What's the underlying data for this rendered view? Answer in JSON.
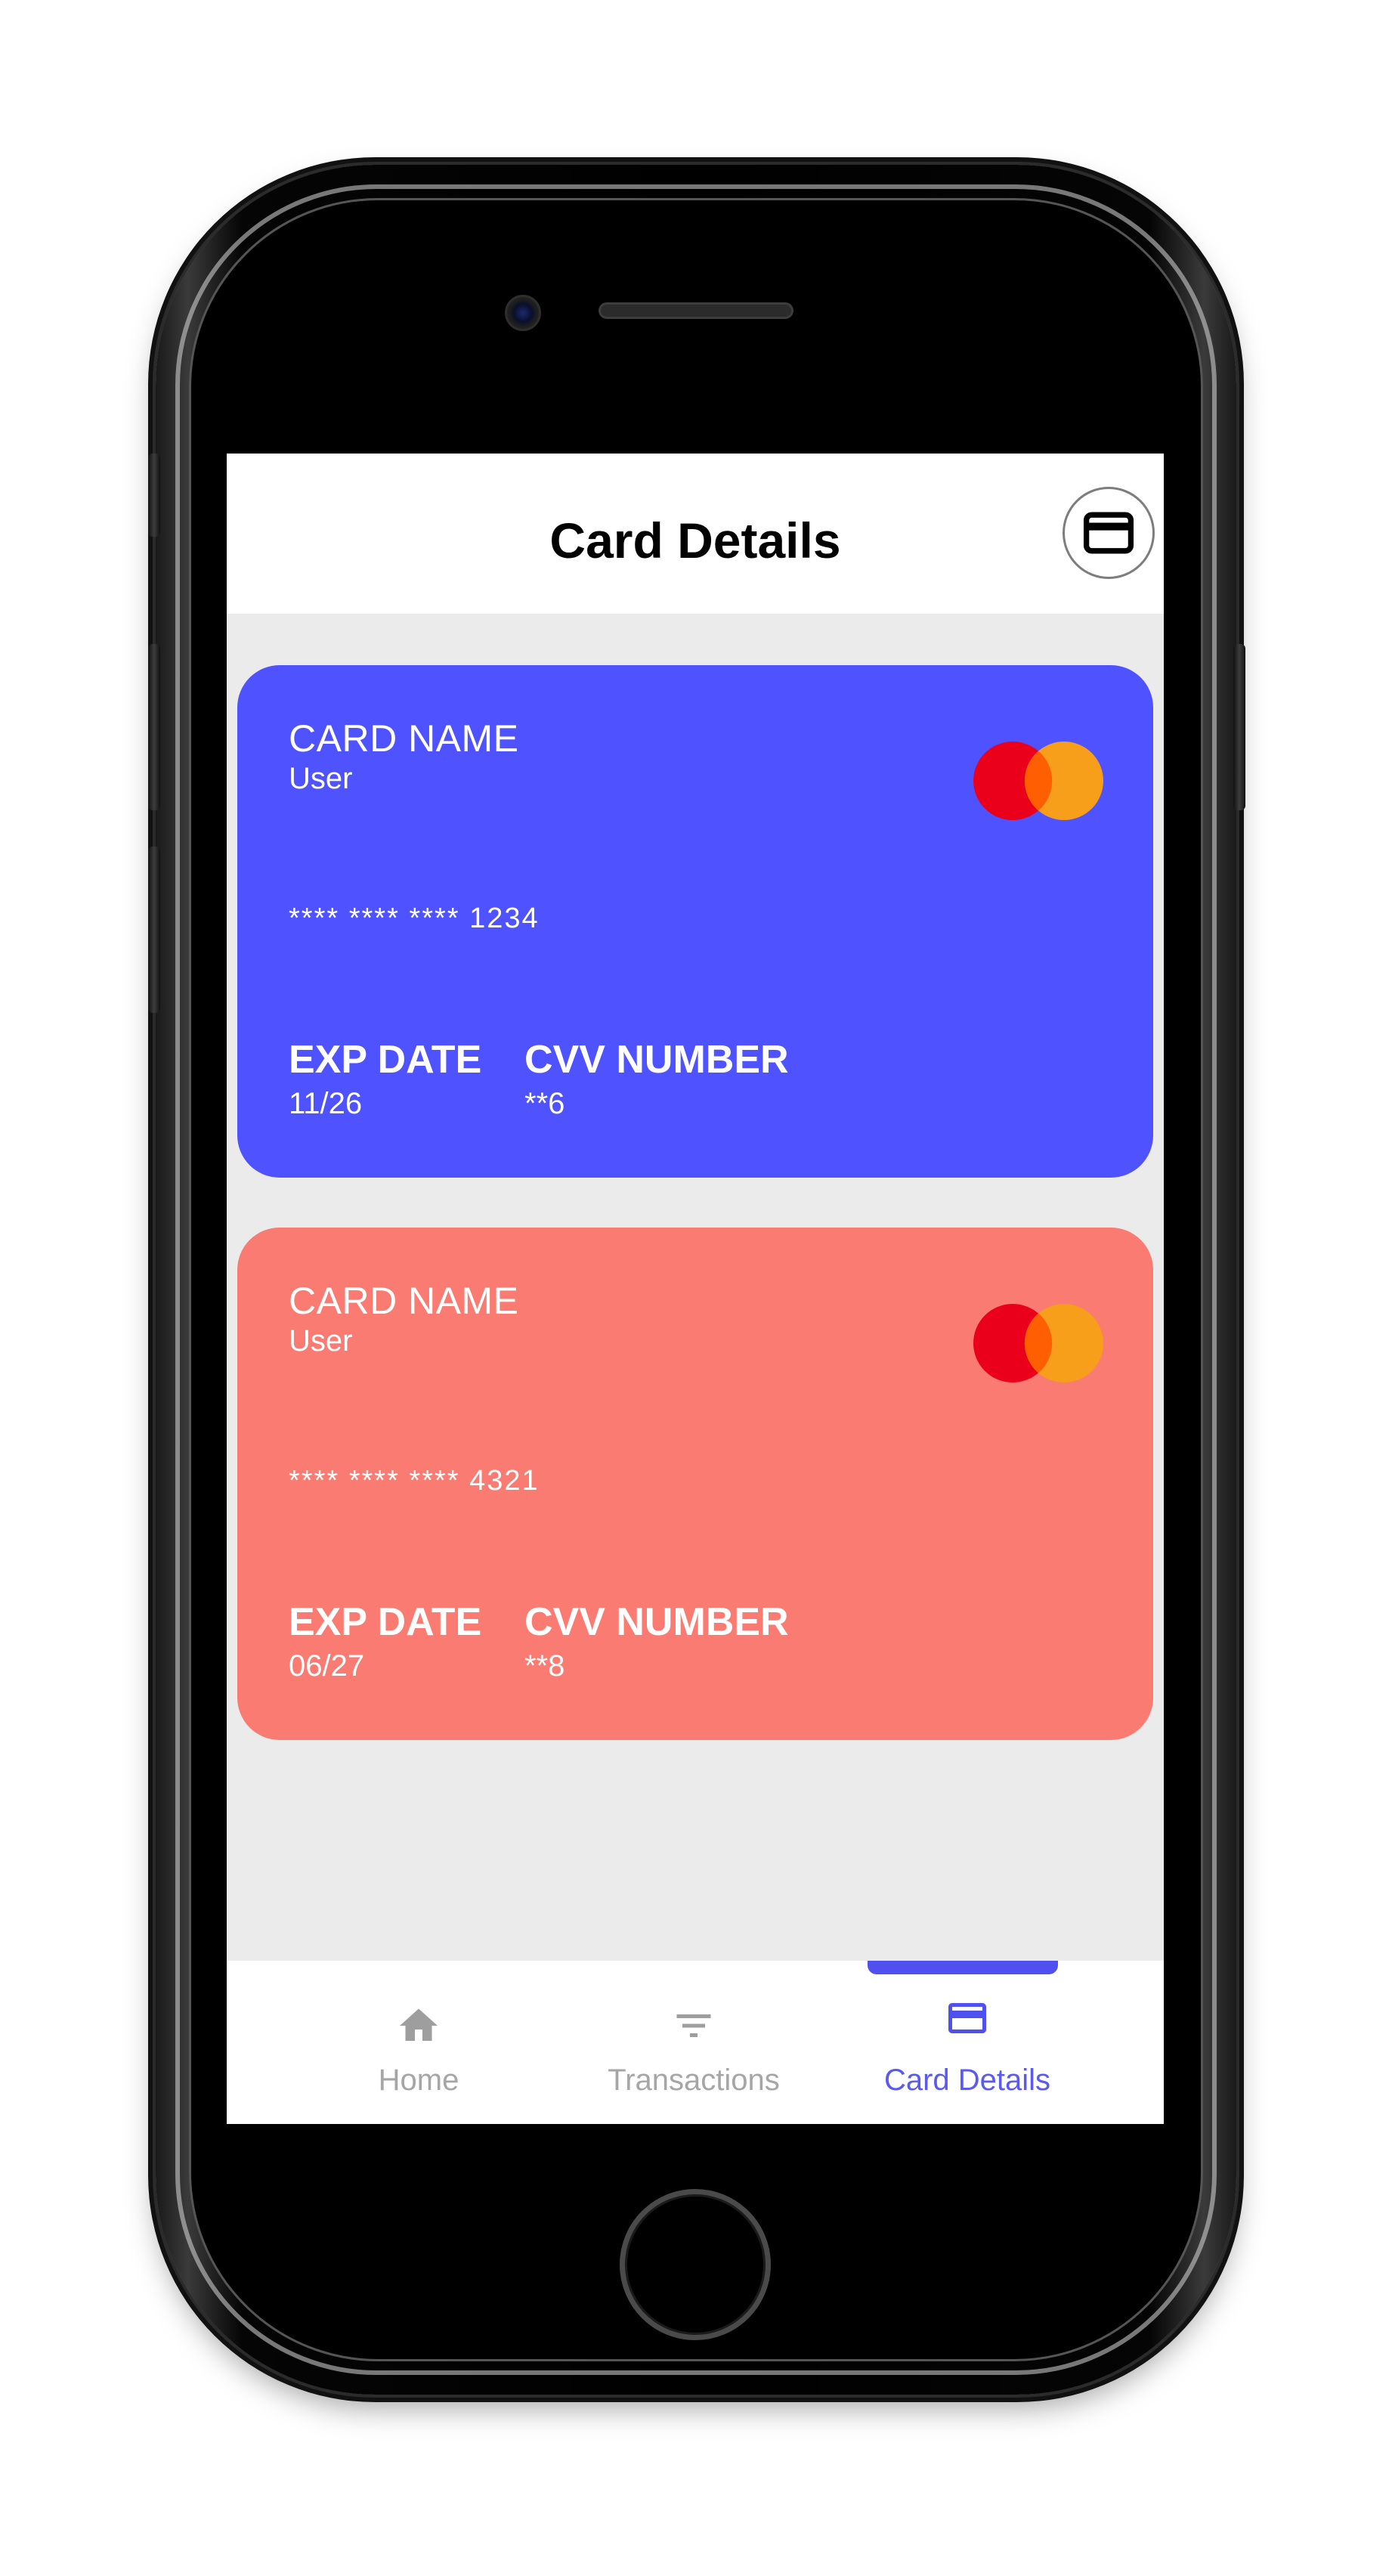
{
  "header": {
    "title": "Card Details",
    "action_icon": "credit-card-icon"
  },
  "cards": [
    {
      "name_label": "CARD NAME",
      "name_value": "User",
      "number": "**** **** **** 1234",
      "exp_label": "EXP DATE",
      "exp_value": "11/26",
      "cvv_label": "CVV NUMBER",
      "cvv_value": "**6",
      "color": "#4f52ff",
      "brand_icon": "mastercard-logo-icon"
    },
    {
      "name_label": "CARD NAME",
      "name_value": "User",
      "number": "**** **** **** 4321",
      "exp_label": "EXP DATE",
      "exp_value": "06/27",
      "cvv_label": "CVV NUMBER",
      "cvv_value": "**8",
      "color": "#f97b71",
      "brand_icon": "mastercard-logo-icon"
    }
  ],
  "bottom_nav": {
    "items": [
      {
        "label": "Home",
        "icon": "home-icon",
        "active": false
      },
      {
        "label": "Transactions",
        "icon": "filter-icon",
        "active": false
      },
      {
        "label": "Card Details",
        "icon": "credit-card-icon",
        "active": true
      }
    ],
    "active_color": "#5050ef",
    "inactive_color": "#a6a6a6"
  },
  "colors": {
    "screen_background": "#ebebeb",
    "header_background": "#ffffff",
    "mastercard_red": "#eb001b",
    "mastercard_orange": "#f79e1b"
  }
}
